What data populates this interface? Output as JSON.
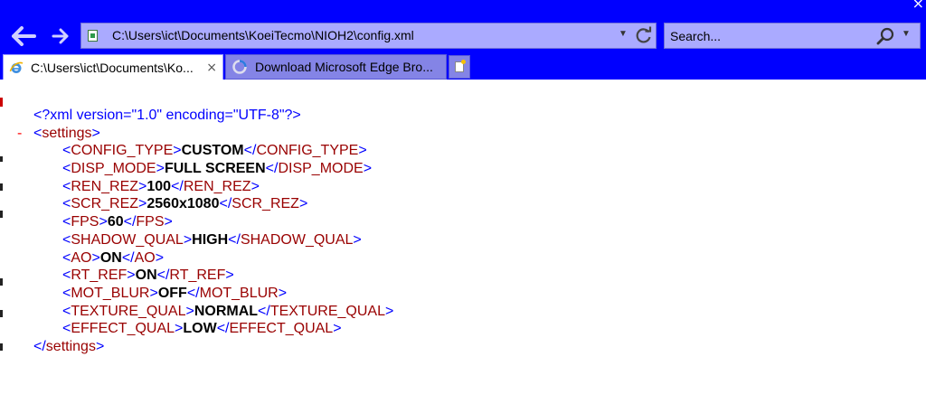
{
  "window": {
    "close_glyph": "×"
  },
  "address_bar": {
    "url": "C:\\Users\\ict\\Documents\\KoeiTecmo\\NIOH2\\config.xml"
  },
  "search": {
    "placeholder": "Search..."
  },
  "tabs": [
    {
      "label": "C:\\Users\\ict\\Documents\\Ko...",
      "icon": "ie-icon",
      "close": "×",
      "active": true
    },
    {
      "label": "Download Microsoft Edge Bro...",
      "icon": "edge-loading-icon",
      "active": false
    }
  ],
  "xml": {
    "declaration": "<?xml version=\"1.0\" encoding=\"UTF-8\"?>",
    "collapse_marker": "-",
    "root": "settings",
    "entries": [
      {
        "tag": "CONFIG_TYPE",
        "value": "CUSTOM"
      },
      {
        "tag": "DISP_MODE",
        "value": "FULL SCREEN"
      },
      {
        "tag": "REN_REZ",
        "value": "100"
      },
      {
        "tag": "SCR_REZ",
        "value": "2560x1080"
      },
      {
        "tag": "FPS",
        "value": "60"
      },
      {
        "tag": "SHADOW_QUAL",
        "value": "HIGH"
      },
      {
        "tag": "AO",
        "value": "ON"
      },
      {
        "tag": "RT_REF",
        "value": "ON"
      },
      {
        "tag": "MOT_BLUR",
        "value": "OFF"
      },
      {
        "tag": "TEXTURE_QUAL",
        "value": "NORMAL"
      },
      {
        "tag": "EFFECT_QUAL",
        "value": "LOW"
      }
    ]
  },
  "colors": {
    "chrome": "#0000ff",
    "address_bg": "#aaaaff",
    "tag_bracket": "#0000ff",
    "tag_name": "#990000",
    "value": "#000000",
    "collapse": "#ff0000"
  }
}
